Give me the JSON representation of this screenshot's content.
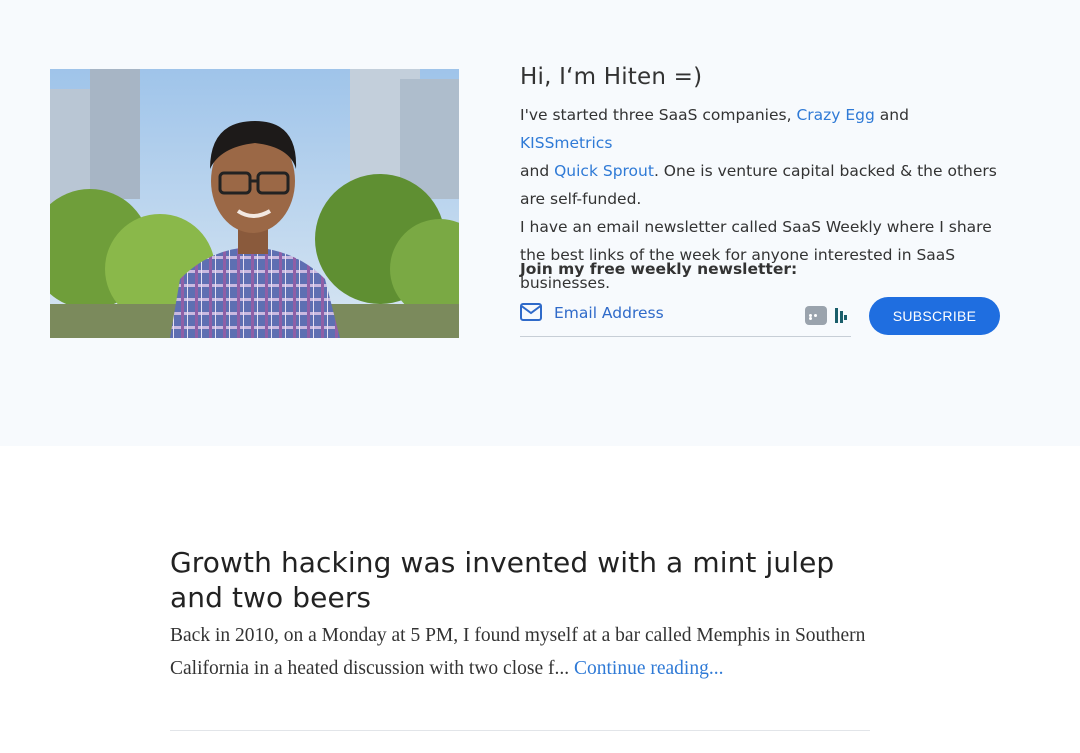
{
  "intro": {
    "greeting": "Hi, I‘m Hiten =)",
    "bio_line1_pre": "I've started three SaaS companies, ",
    "link_crazy_egg": "Crazy Egg",
    "and_1": " and ",
    "link_kissmetrics": "KISSmetrics",
    "and_2": " and ",
    "link_quick_sprout": "Quick Sprout",
    "bio_line1_post": ". One is venture capital backed & the others are self-funded.",
    "bio_line2": "I have an email newsletter called SaaS Weekly where I share the best links of the week for anyone interested in SaaS businesses."
  },
  "newsletter": {
    "label": "Join my free weekly newsletter:",
    "email_placeholder": "Email Address",
    "email_value": "",
    "subscribe_label": "SUBSCRIBE"
  },
  "post": {
    "title": "Growth hacking was invented with a mint julep and two beers",
    "excerpt": "Back in 2010, on a Monday at 5 PM, I found myself at a bar called Memphis in Southern California in a heated discussion with two close f... ",
    "continue_label": "Continue reading..."
  },
  "colors": {
    "hero_background": "#f7fafd",
    "link": "#2f7ad6",
    "button": "#1f6ee0"
  },
  "icons": {
    "email": "mail-icon",
    "password_manager": "password-manager-icon",
    "extension": "extension-icon"
  }
}
